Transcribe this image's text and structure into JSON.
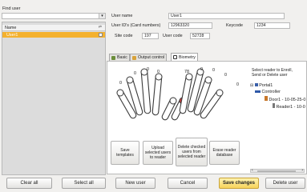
{
  "find_user": {
    "label": "Find user",
    "value": ""
  },
  "user_list": {
    "column_name": "Name",
    "items": [
      "User1"
    ]
  },
  "details": {
    "user_name_label": "User name",
    "user_name_value": "User1",
    "card_label": "User ID's (Card numbers)",
    "card_value": "12963320",
    "keycode_label": "Keycode",
    "keycode_value": "1234",
    "site_label": "Site code",
    "site_value": "197",
    "usercode_label": "User code",
    "usercode_value": "52728"
  },
  "tabs": [
    {
      "label": "Basic",
      "icon": "basic-icon"
    },
    {
      "label": "Output control",
      "icon": "output-control-icon"
    },
    {
      "label": "Biometry",
      "icon": "biometry-icon"
    }
  ],
  "biometry": {
    "finger_counts": [
      "0",
      "0",
      "0",
      "0",
      "78",
      "0",
      "0",
      "0",
      "0"
    ],
    "enrolled_color": "#e23b3b",
    "reader_instruction": "Select reader to Enroll, Send or Delete user",
    "tree": [
      "Portal1",
      "Controller",
      "Door1 - 10-05-25-0",
      "Reader1 - 10-0"
    ],
    "actions": [
      "Save templates",
      "Upload selected users to reader",
      "Delete checked users from selected reader",
      "Erase reader database"
    ]
  },
  "footer": {
    "clear_all": "Clear all",
    "select_all": "Select all",
    "new_user": "New user",
    "cancel": "Cancel",
    "save_changes": "Save changes",
    "delete_user": "Delete user"
  },
  "colors": {
    "selected_row": "#f4b12e",
    "save_highlight": "#f7d35a"
  }
}
